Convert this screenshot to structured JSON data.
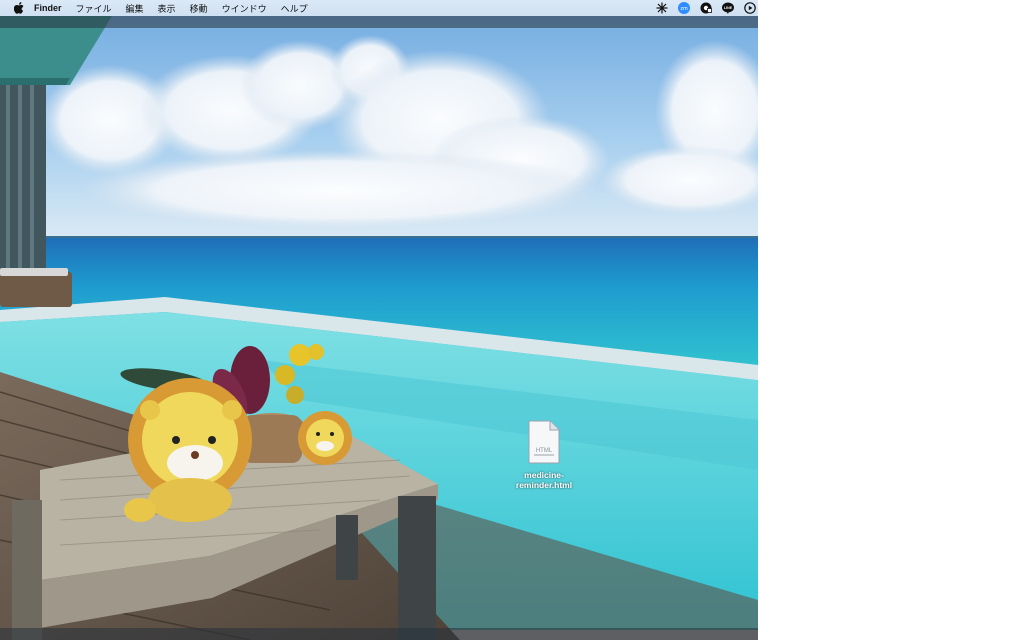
{
  "menubar": {
    "app_name": "Finder",
    "items": [
      "ファイル",
      "編集",
      "表示",
      "移動",
      "ウインドウ",
      "ヘルプ"
    ],
    "status_icons": [
      "sparkle-icon",
      "zoom-icon",
      "screen-record-icon",
      "line-icon",
      "play-icon"
    ],
    "zoom_label": "zm",
    "line_label": "LINE"
  },
  "desktop": {
    "wallpaper": "ocean-infinity-pool-with-lion-plush",
    "file": {
      "name": "medicine-\nreminder.html",
      "kind_label": "HTML",
      "icon": "html-document-icon"
    }
  },
  "colors": {
    "menubar": "#d5e5f5",
    "sea": "#2fb6c8",
    "sky": "#8fc3ec",
    "pool": "#5fd3dc"
  }
}
